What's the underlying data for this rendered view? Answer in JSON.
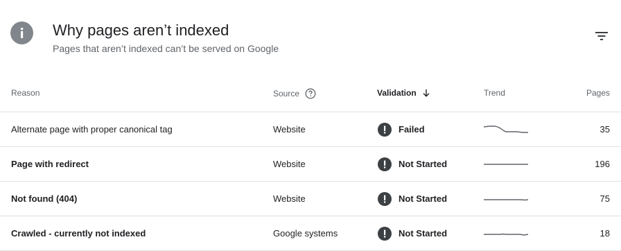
{
  "header": {
    "icon": "info-icon",
    "title": "Why pages aren’t indexed",
    "subtitle": "Pages that aren’t indexed can’t be served on Google",
    "filter_icon": "filter-icon"
  },
  "table": {
    "columns": {
      "reason": "Reason",
      "source": "Source",
      "validation": "Validation",
      "trend": "Trend",
      "pages": "Pages"
    },
    "sorted_by": "Validation",
    "rows": [
      {
        "reason": "Alternate page with proper canonical tag",
        "source": "Website",
        "validation": "Failed",
        "pages": "35"
      },
      {
        "reason": "Page with redirect",
        "source": "Website",
        "validation": "Not Started",
        "pages": "196"
      },
      {
        "reason": "Not found (404)",
        "source": "Website",
        "validation": "Not Started",
        "pages": "75"
      },
      {
        "reason": "Crawled - currently not indexed",
        "source": "Google systems",
        "validation": "Not Started",
        "pages": "18"
      }
    ]
  },
  "colors": {
    "status_icon": "#3c4043",
    "info_icon": "#80868b",
    "divider": "#e0e0e0",
    "sparkline": "#5f6368"
  }
}
